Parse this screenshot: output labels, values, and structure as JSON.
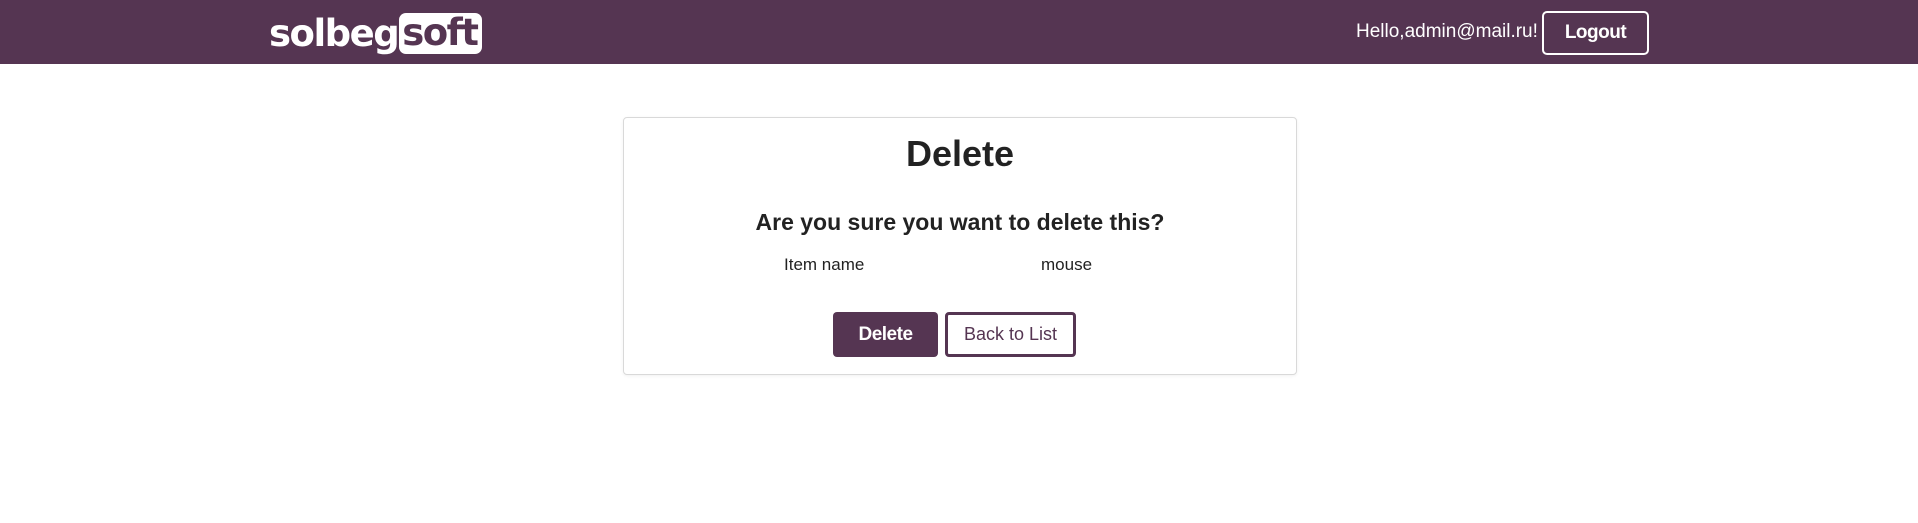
{
  "navbar": {
    "logo_text_part1": "solbeg",
    "logo_text_part2": "soft",
    "greeting": "Hello,admin@mail.ru!",
    "logout_label": "Logout",
    "background_color": "#553552"
  },
  "card": {
    "title": "Delete",
    "question": "Are you sure you want to delete this?",
    "field": {
      "label": "Item name",
      "value": "mouse"
    },
    "delete_label": "Delete",
    "back_label": "Back to List"
  },
  "colors": {
    "brand": "#553552",
    "text": "#222222",
    "card_border": "#d9d9d9"
  }
}
